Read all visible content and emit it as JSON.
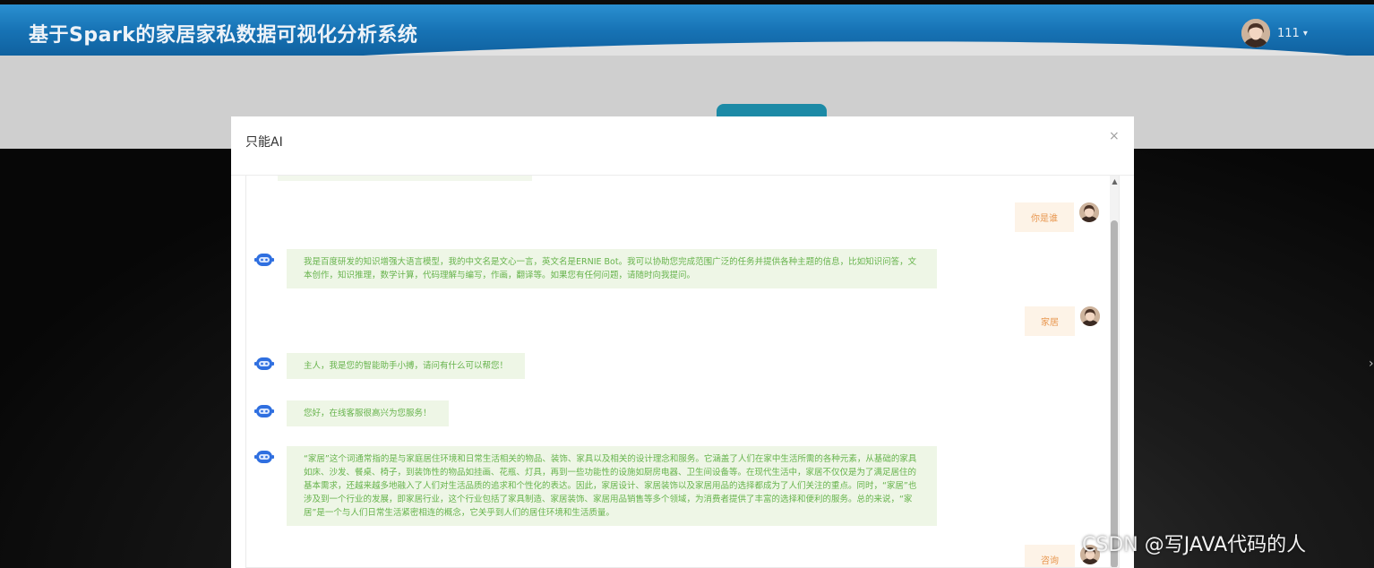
{
  "header": {
    "title": "基于Spark的家居家私数据可视化分析系统",
    "user_name": "111",
    "caret": "▾"
  },
  "modal": {
    "title": "只能AI",
    "close_label": "×"
  },
  "messages": [
    {
      "role": "user",
      "text": "你是谁"
    },
    {
      "role": "bot",
      "text": "我是百度研发的知识增强大语言模型，我的中文名是文心一言，英文名是ERNIE Bot。我可以协助您完成范围广泛的任务并提供各种主题的信息，比如知识问答，文本创作，知识推理，数学计算，代码理解与编写，作画，翻译等。如果您有任何问题，请随时向我提问。"
    },
    {
      "role": "user",
      "text": "家居"
    },
    {
      "role": "bot",
      "text": "主人，我是您的智能助手小搏，请问有什么可以帮您！"
    },
    {
      "role": "bot",
      "text": "您好，在线客服很高兴为您服务！"
    },
    {
      "role": "bot",
      "text": "“家居”这个词通常指的是与家庭居住环境和日常生活相关的物品、装饰、家具以及相关的设计理念和服务。它涵盖了人们在家中生活所需的各种元素，从基础的家具如床、沙发、餐桌、椅子，到装饰性的物品如挂画、花瓶、灯具，再到一些功能性的设施如厨房电器、卫生间设备等。在现代生活中，家居不仅仅是为了满足居住的基本需求，还越来越多地融入了人们对生活品质的追求和个性化的表达。因此，家居设计、家居装饰以及家居用品的选择都成为了人们关注的重点。同时，“家居”也涉及到一个行业的发展，即家居行业，这个行业包括了家具制造、家居装饰、家居用品销售等多个领域，为消费者提供了丰富的选择和便利的服务。总的来说，“家居”是一个与人们日常生活紧密相连的概念，它关乎到人们的居住环境和生活质量。"
    },
    {
      "role": "user",
      "text": "咨询"
    }
  ],
  "watermark": "CSDN @写JAVA代码的人",
  "colors": {
    "header_blue": "#1773b5",
    "user_bubble_bg": "#fdf3e7",
    "user_bubble_text": "#e8964e",
    "bot_bubble_bg": "#eef6e6",
    "bot_bubble_text": "#66b34b",
    "bot_icon": "#2f6fe0"
  }
}
